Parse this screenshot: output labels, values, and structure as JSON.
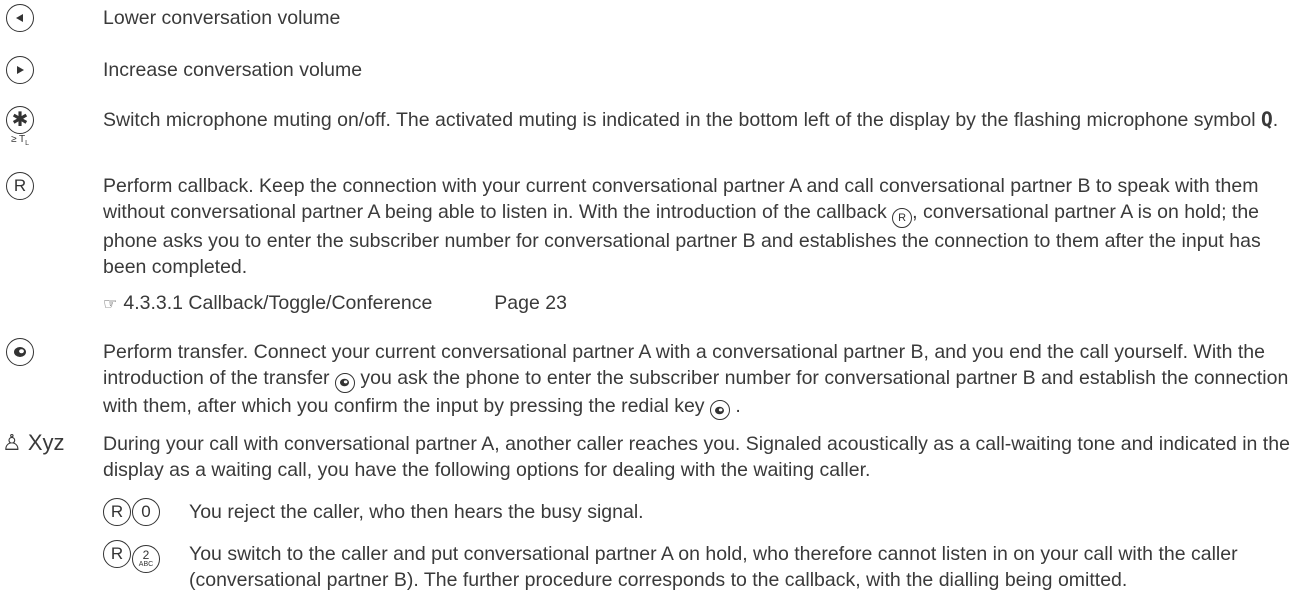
{
  "rows": {
    "lower_volume": {
      "text": "Lower conversation volume"
    },
    "increase_volume": {
      "text": "Increase conversation volume"
    },
    "mute": {
      "sublabel": "≥ T",
      "sublabel_sub": "L",
      "text_before": "Switch microphone muting on/off. The activated muting is indicated in the bottom left of the display by the flashing microphone symbol ",
      "mic_glyph": "Q",
      "text_after": "."
    },
    "callback": {
      "key_label": "R",
      "text_before": "Perform callback. Keep the connection with your current conversational partner A and call conversational partner B to speak with them without conversational partner A being able to listen in. With the introduction of the callback ",
      "inline_key": "R",
      "text_after": ", conversational partner A is on hold; the phone asks you to enter the subscriber number for conversational partner B and establishes the connection to them after the input has been completed."
    },
    "reference": {
      "pointer": "☞",
      "section": "4.3.3.1 Callback/Toggle/Conference",
      "page": "Page 23"
    },
    "transfer": {
      "text_before": "Perform transfer. Connect your current conversational partner A with a conversational partner B, and you end the call yourself. With the introduction of the transfer ",
      "text_middle": " you ask the phone to enter the subscriber number for conversational partner B and establish the connection with them, after which you confirm the input by pressing the redial key ",
      "text_after": " ."
    },
    "call_waiting": {
      "symbol": "♙ Xyz",
      "text": "During your call with conversational partner A, another caller reaches you. Signaled acoustically as a call-waiting tone and indicated in the display as a waiting call, you have the following options for dealing with the waiting caller."
    }
  },
  "options": [
    {
      "key1": "R",
      "key2": "0",
      "key2_sub": "",
      "text": "You reject the caller, who then hears the busy signal."
    },
    {
      "key1": "R",
      "key2": "2",
      "key2_sub": "ABC",
      "text": "You switch to the caller and put conversational partner A on hold, who therefore cannot listen in on your call with the caller (conversational partner B). The further procedure corresponds to the callback, with the dialling being omitted."
    }
  ],
  "icons": {
    "lower_volume_key": "left-arrow-key-icon",
    "increase_volume_key": "right-arrow-key-icon",
    "mute_key": "star-key-icon",
    "callback_key": "r-key-icon",
    "transfer_key": "redial-key-icon",
    "call_waiting": "bell-icon"
  }
}
